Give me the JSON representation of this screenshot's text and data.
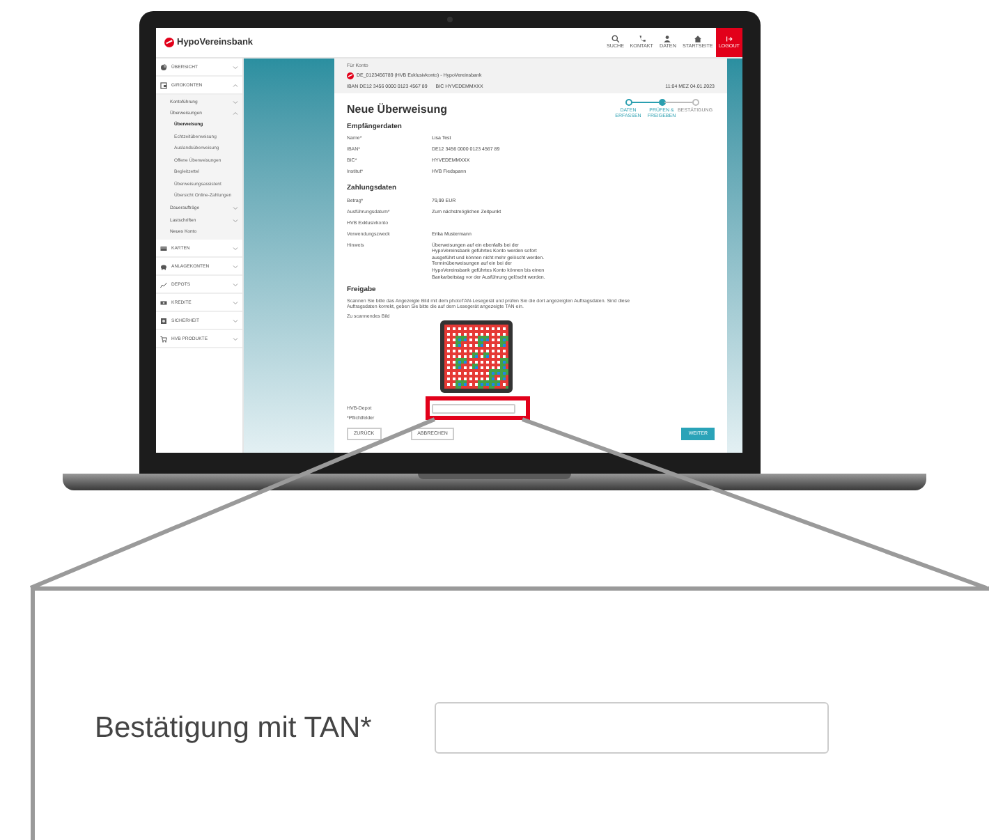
{
  "app_bar": {
    "logo": "HypoVereinsbank",
    "actions": [
      {
        "label": "SUCHE",
        "kind": "search"
      },
      {
        "label": "KONTAKT",
        "kind": "phone"
      },
      {
        "label": "DATEN",
        "kind": "person"
      },
      {
        "label": "STARTSEITE",
        "kind": "home"
      },
      {
        "label": "LOGOUT",
        "kind": "logout"
      }
    ]
  },
  "sidebar": {
    "items": [
      {
        "label": "ÜBERSICHT",
        "expanded": false
      },
      {
        "label": "GIROKONTEN",
        "expanded": true,
        "children": [
          {
            "label": "Kontoführung",
            "expanded": false
          },
          {
            "label": "Überweisungen",
            "expanded": true,
            "children": [
              {
                "label": "Überweisung",
                "selected": true
              },
              {
                "label": "Echtzeitüberweisung",
                "selected": false
              },
              {
                "label": "Auslandsüberweisung",
                "selected": false
              },
              {
                "label": "Offene Überweisungen",
                "selected": false
              },
              {
                "label": "Begleitzettel",
                "selected": false
              },
              {
                "label": "Überweisungsassistent",
                "selected": false
              },
              {
                "label": "Übersicht Online-Zahlungen",
                "selected": false
              }
            ]
          },
          {
            "label": "Daueraufträge",
            "expanded": false
          },
          {
            "label": "Lastschriften",
            "expanded": false
          },
          {
            "label": "Neues Konto"
          }
        ]
      },
      {
        "label": "KARTEN",
        "expanded": false
      },
      {
        "label": "ANLAGEKONTEN",
        "expanded": false
      },
      {
        "label": "DEPOTS",
        "expanded": false
      },
      {
        "label": "KREDITE",
        "expanded": false
      },
      {
        "label": "SICHERHEIT",
        "expanded": false
      },
      {
        "label": "HVB PRODUKTE",
        "expanded": false
      }
    ]
  },
  "account": {
    "caption": "Für Konto",
    "name": "DE_0123456789 (HVB Exklusivkonto) - HypoVereinsbank",
    "iban": "IBAN DE12 3456 0000 0123 4567 89",
    "bic": "BIC HYVEDEMMXXX",
    "timestamp": "11:04 MEZ 04.01.2023"
  },
  "title": "Neue Überweisung",
  "steps": [
    {
      "label": "DATEN ERFASSEN",
      "completed": true,
      "selected": false
    },
    {
      "label": "PRÜFEN & FREIGEBEN",
      "completed": true,
      "selected": true
    },
    {
      "label": "BESTÄTIGUNG",
      "completed": false,
      "selected": false
    }
  ],
  "sections": [
    {
      "heading": "Empfängerdaten",
      "rows": [
        {
          "label": "Name*",
          "value": "Lisa Test"
        },
        {
          "label": "IBAN*",
          "value": "DE12 3456 0000 0123 4567 89"
        },
        {
          "label": "BIC*",
          "value": "HYVEDEMMXXX"
        },
        {
          "label": "Institut*",
          "value": "HVB Fiedspann"
        }
      ]
    },
    {
      "heading": "Zahlungsdaten",
      "rows": [
        {
          "label": "Betrag*",
          "value": "79,99 EUR"
        },
        {
          "label": "Ausführungsdatum*",
          "value": "Zum nächstmöglichen Zeitpunkt"
        },
        {
          "label": "HVB Exklusivkonto"
        },
        {
          "label": "Verwendungszweck",
          "value": "Erika Mustermann"
        },
        {
          "label": "Hinweis",
          "value": "Überweisungen auf ein ebenfalls bei der HypoVereinsbank geführtes Konto werden sofort ausgeführt und können nicht mehr gelöscht werden. Terminüberweisungen auf ein bei der HypoVereinsbank geführtes Konto können bis einen Bankarbeitstag vor der Ausführung gelöscht werden."
        }
      ]
    }
  ],
  "release": {
    "heading": "Freigabe",
    "instructions": "Scannen Sie bitte das Angezeigte Bild mit dem photoTAN-Lesegerät und prüfen Sie die dort angezeigten Auftragsdaten. Sind diese Auftragsdaten korrekt, geben Sie bitte die auf dem Lesegerät angezeigte TAN ein.",
    "image_caption": "Zu scannendes Bild",
    "tan_label": "HVB-Depot",
    "required_note": "*Pflichtfelder"
  },
  "buttons": [
    {
      "label": "ZURÜCK",
      "kind": "secondary"
    },
    {
      "label": "ABBRECHEN",
      "kind": "secondary"
    },
    {
      "label": "WEITER",
      "kind": "primary"
    }
  ],
  "callout": {
    "label": "Bestätigung mit TAN*"
  }
}
